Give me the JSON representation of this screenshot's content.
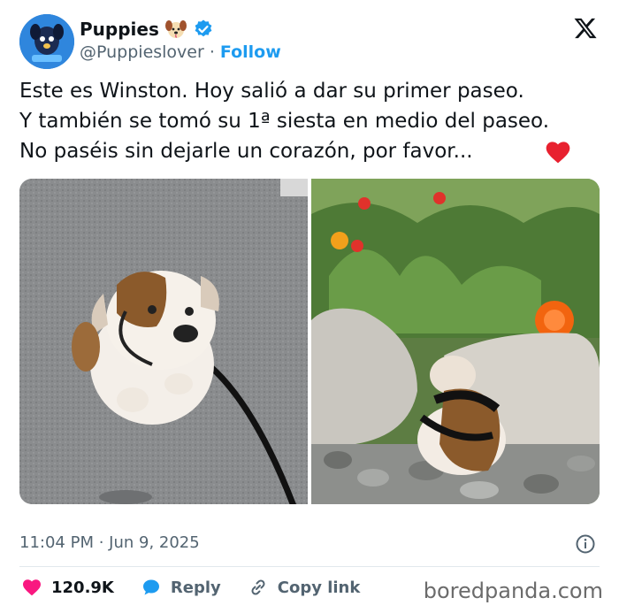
{
  "author": {
    "name": "Puppies",
    "handle": "@Puppieslover",
    "separator": "·",
    "follow_label": "Follow"
  },
  "tweet": {
    "lines": [
      "Este es Winston. Hoy salió a dar su primer paseo.",
      "Y también se tomó su 1ª siesta en medio del paseo.",
      "No paséis sin dejarle un corazón, por favor..."
    ],
    "timestamp": "11:04 PM · Jun 9, 2025"
  },
  "actions": {
    "like_count": "120.9K",
    "reply_label": "Reply",
    "copy_label": "Copy link"
  },
  "watermark": "boredpanda.com",
  "colors": {
    "accent": "#1d9bf0",
    "heart": "#f91880",
    "text": "#0f1419",
    "muted": "#536471"
  },
  "icons": [
    "dog-face-icon",
    "verified-badge-icon",
    "x-logo-icon",
    "red-heart-icon",
    "info-icon",
    "heart-icon",
    "reply-bubble-icon",
    "copy-link-icon"
  ]
}
